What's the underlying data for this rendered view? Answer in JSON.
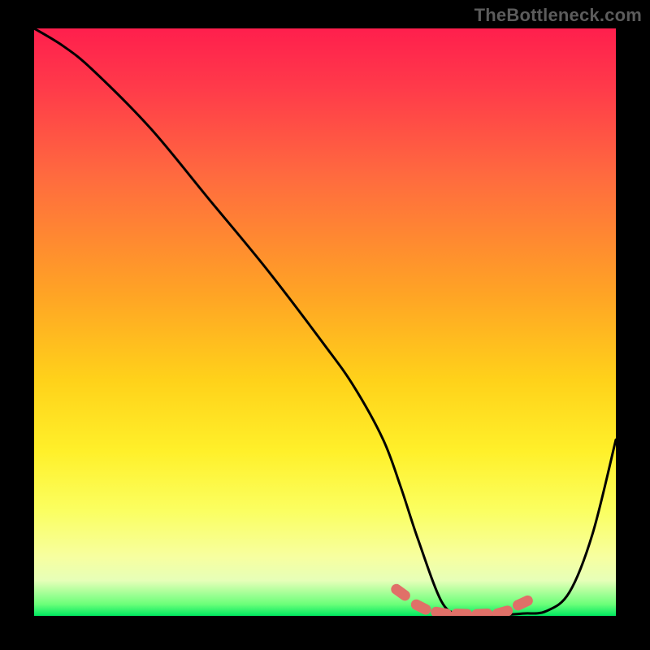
{
  "watermark": "TheBottleneck.com",
  "chart_data": {
    "type": "line",
    "title": "",
    "xlabel": "",
    "ylabel": "",
    "xlim": [
      0,
      100
    ],
    "ylim": [
      0,
      100
    ],
    "grid": false,
    "legend": false,
    "background_gradient": {
      "top": "#ff1f4d",
      "mid": "#ffd21a",
      "bottom": "#00e860"
    },
    "series": [
      {
        "name": "bottleneck-curve",
        "x": [
          0,
          5,
          10,
          20,
          30,
          40,
          50,
          55,
          60,
          63,
          66,
          70,
          73,
          76,
          80,
          84,
          88,
          92,
          96,
          100
        ],
        "y": [
          100,
          97,
          93,
          83,
          71,
          59,
          46,
          39,
          30,
          22,
          13,
          2.5,
          0.2,
          0,
          0.1,
          0.4,
          0.8,
          4,
          14,
          30
        ]
      },
      {
        "name": "minimum-markers",
        "x": [
          63,
          66.5,
          70,
          73.5,
          77,
          80.5,
          84
        ],
        "y": [
          4,
          1.5,
          0.5,
          0.3,
          0.3,
          0.6,
          2.2
        ]
      }
    ],
    "colors": {
      "curve": "#000000",
      "markers": "#e07068"
    }
  }
}
